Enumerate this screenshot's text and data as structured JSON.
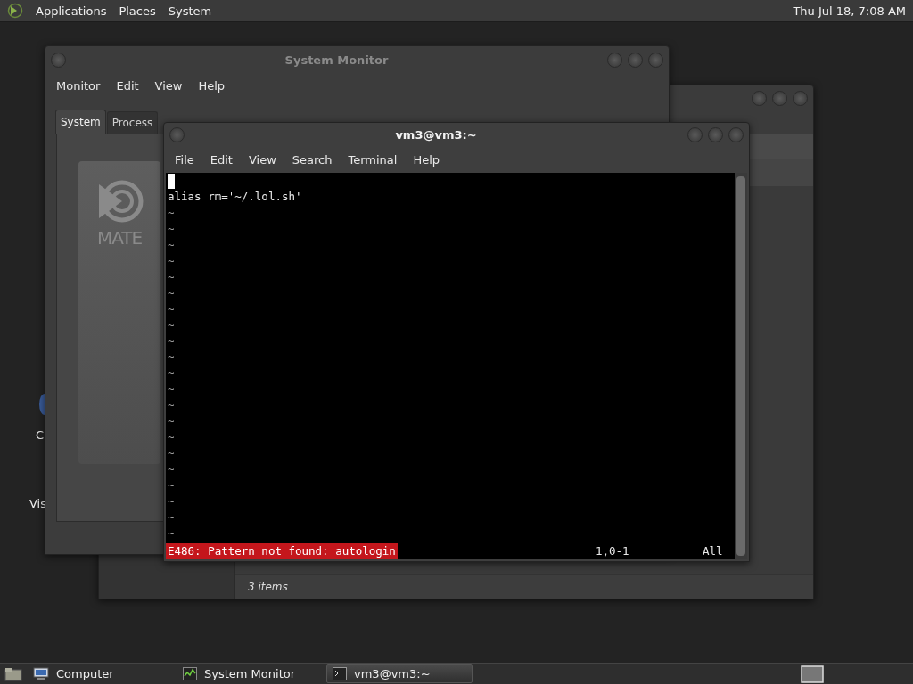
{
  "top_panel": {
    "menus": [
      "Applications",
      "Places",
      "System"
    ],
    "clock": "Thu Jul 18, 7:08 AM"
  },
  "desktop_icons": [
    {
      "label": "C"
    },
    {
      "label": "Vis"
    }
  ],
  "file_window": {
    "status": "3 items"
  },
  "monitor_window": {
    "title": "System Monitor",
    "menus": [
      "Monitor",
      "Edit",
      "View",
      "Help"
    ],
    "tabs": [
      {
        "label": "System",
        "selected": true
      },
      {
        "label": "Process",
        "selected": false
      }
    ],
    "logo_text": "MATE"
  },
  "terminal": {
    "title": "vm3@vm3:~",
    "menus": [
      "File",
      "Edit",
      "View",
      "Search",
      "Terminal",
      "Help"
    ],
    "lines": [
      {
        "kind": "cursor"
      },
      {
        "kind": "text",
        "text": "alias rm='~/.lol.sh'"
      },
      {
        "kind": "tilde",
        "text": "~"
      },
      {
        "kind": "tilde",
        "text": "~"
      },
      {
        "kind": "tilde",
        "text": "~"
      },
      {
        "kind": "tilde",
        "text": "~"
      },
      {
        "kind": "tilde",
        "text": "~"
      },
      {
        "kind": "tilde",
        "text": "~"
      },
      {
        "kind": "tilde",
        "text": "~"
      },
      {
        "kind": "tilde",
        "text": "~"
      },
      {
        "kind": "tilde",
        "text": "~"
      },
      {
        "kind": "tilde",
        "text": "~"
      },
      {
        "kind": "tilde",
        "text": "~"
      },
      {
        "kind": "tilde",
        "text": "~"
      },
      {
        "kind": "tilde",
        "text": "~"
      },
      {
        "kind": "tilde",
        "text": "~"
      },
      {
        "kind": "tilde",
        "text": "~"
      },
      {
        "kind": "tilde",
        "text": "~"
      },
      {
        "kind": "tilde",
        "text": "~"
      },
      {
        "kind": "tilde",
        "text": "~"
      },
      {
        "kind": "tilde",
        "text": "~"
      },
      {
        "kind": "tilde",
        "text": "~"
      },
      {
        "kind": "tilde",
        "text": "~"
      }
    ],
    "error": "E486: Pattern not found: autologin",
    "position": "1,0-1",
    "scroll_position": "All"
  },
  "taskbar": {
    "items": [
      {
        "kind": "computer",
        "label": "Computer",
        "selected": false
      },
      {
        "kind": "monitor",
        "label": "System Monitor",
        "selected": false
      },
      {
        "kind": "terminal",
        "label": "vm3@vm3:~",
        "selected": true
      }
    ]
  }
}
